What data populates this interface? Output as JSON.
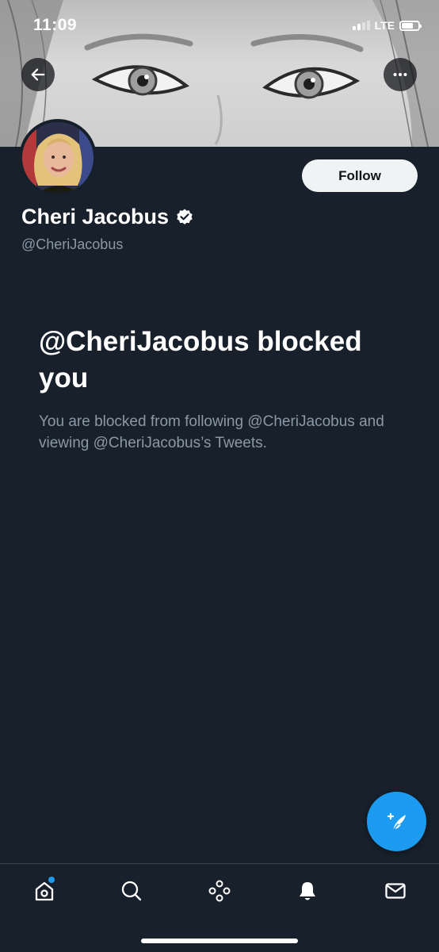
{
  "status_bar": {
    "time": "11:09",
    "network": "LTE",
    "battery_level": 0.75
  },
  "header": {
    "back_icon": "arrow-left-icon",
    "more_icon": "ellipsis-icon"
  },
  "profile": {
    "display_name": "Cheri Jacobus",
    "handle": "@CheriJacobus",
    "verified": true,
    "follow_label": "Follow"
  },
  "blocked": {
    "title": "@CheriJacobus blocked you",
    "description": "You are blocked from following @CheriJacobus and viewing @CheriJacobus’s Tweets."
  },
  "compose": {
    "icon": "compose-tweet-icon"
  },
  "tabbar": {
    "items": [
      {
        "name": "home",
        "icon": "home-icon",
        "has_notification_dot": true
      },
      {
        "name": "search",
        "icon": "search-icon"
      },
      {
        "name": "spaces",
        "icon": "spaces-icon"
      },
      {
        "name": "notifications",
        "icon": "bell-icon",
        "active": true
      },
      {
        "name": "messages",
        "icon": "mail-icon"
      }
    ]
  },
  "colors": {
    "background": "#18202b",
    "accent": "#1d9bf0",
    "secondary_text": "#8b98a5",
    "follow_button_bg": "#eff3f4"
  }
}
